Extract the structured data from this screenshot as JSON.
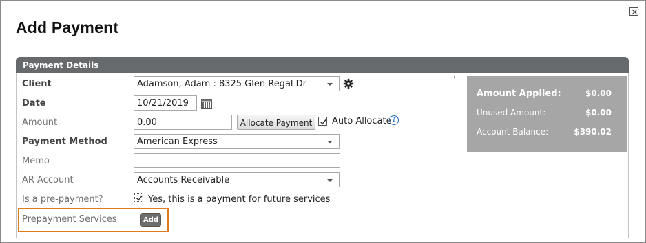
{
  "dialog": {
    "title": "Add Payment"
  },
  "panel": {
    "header": "Payment Details"
  },
  "form": {
    "client": {
      "label": "Client",
      "value": "Adamson, Adam : 8325 Glen Regal Dr"
    },
    "date": {
      "label": "Date",
      "value": "10/21/2019"
    },
    "amount": {
      "label": "Amount",
      "value": "0.00",
      "allocate_button": "Allocate Payment",
      "auto_allocate_label": "Auto Allocate",
      "auto_allocate_checked": true
    },
    "payment_method": {
      "label": "Payment Method",
      "value": "American Express"
    },
    "memo": {
      "label": "Memo",
      "value": ""
    },
    "ar_account": {
      "label": "AR Account",
      "value": "Accounts Receivable"
    },
    "prepayment": {
      "label": "Is a pre-payment?",
      "checkbox_label": "Yes, this is a payment for future services",
      "checked": true
    },
    "prepayment_services": {
      "label": "Prepayment Services",
      "add_button": "Add"
    }
  },
  "summary": {
    "amount_applied": {
      "label": "Amount Applied:",
      "value": "$0.00"
    },
    "unused_amount": {
      "label": "Unused Amount:",
      "value": "$0.00"
    },
    "account_balance": {
      "label": "Account Balance:",
      "value": "$390.02"
    }
  },
  "colors": {
    "panel_header_bg": "#666a6d",
    "summary_bg": "#a6a6a6",
    "highlight": "#e07b1a",
    "help_icon": "#2a6fbf"
  },
  "icons": [
    "close-icon",
    "gear-icon",
    "calendar-icon",
    "help-icon",
    "checkmark-icon",
    "chevron-down-icon"
  ]
}
